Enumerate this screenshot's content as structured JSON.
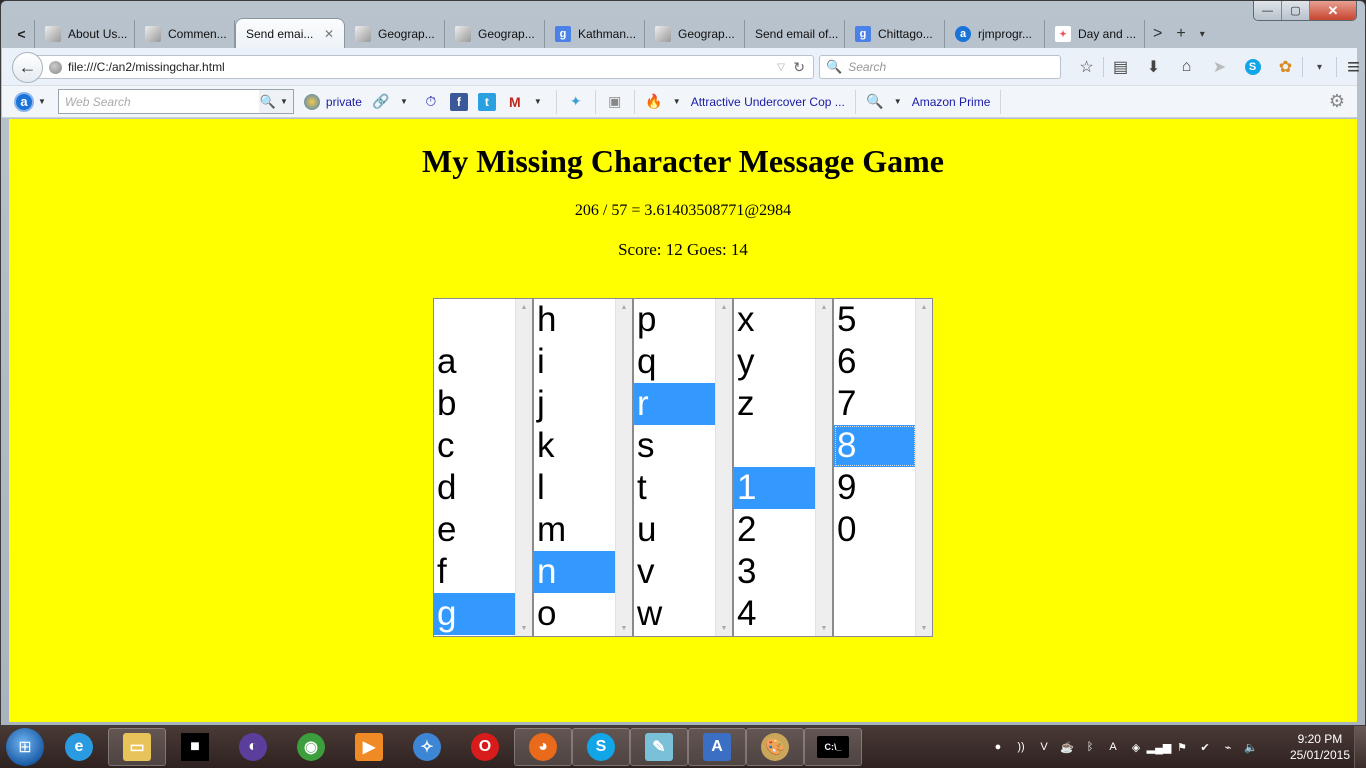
{
  "window": {
    "controls": {
      "minimize": "—",
      "maximize": "▢",
      "close": "✕"
    }
  },
  "tabs": [
    {
      "label": "About Us...",
      "favicon": "globe-favicon"
    },
    {
      "label": "Commen...",
      "favicon": "globe-favicon"
    },
    {
      "label": "Send emai...",
      "favicon": "none",
      "active": true
    },
    {
      "label": "Geograp...",
      "favicon": "globe-favicon"
    },
    {
      "label": "Geograp...",
      "favicon": "globe-favicon"
    },
    {
      "label": "Kathman...",
      "favicon": "google-favicon"
    },
    {
      "label": "Geograp...",
      "favicon": "globe-favicon"
    },
    {
      "label": "Send email of...",
      "favicon": "none"
    },
    {
      "label": "Chittago...",
      "favicon": "google-favicon"
    },
    {
      "label": "rjmprogr...",
      "favicon": "a-favicon"
    },
    {
      "label": "Day and ...",
      "favicon": "day-favicon"
    }
  ],
  "tab_glyphs": {
    "scroll_left": "<",
    "close": "✕",
    "scroll_right": ">",
    "new_tab": "+",
    "list_all": "▾",
    "google": "g",
    "a": "a",
    "day": "✦"
  },
  "navbar": {
    "back": "←",
    "url": "file:///C:/an2/missingchar.html",
    "url_dropdown": "▽",
    "reload": "↻",
    "search_placeholder": "Search",
    "search_icon": "🔍",
    "icons": {
      "bookmark": "☆",
      "reading_list": "▤",
      "download": "⬇",
      "home": "⌂",
      "send": "➤",
      "skype": "S",
      "bug": "✿",
      "more": "▾",
      "menu": "≡"
    }
  },
  "toolbar": {
    "a_logo": "a",
    "caret": "▼",
    "web_search_placeholder": "Web Search",
    "search_icon": "🔍",
    "private_label": "private",
    "link_icon": "🔗",
    "timer_icon": "⏱",
    "facebook_icon": "f",
    "twitter_icon": "t",
    "gmail_icon": "M",
    "sparkle_icon": "✦",
    "contact_icon": "▣",
    "fire_icon": "🔥",
    "attractive_label": "Attractive Undercover Cop ...",
    "search_fire_icon": "🔍",
    "amazon_label": "Amazon Prime",
    "gear_icon": "⚙"
  },
  "page": {
    "title": "My Missing Character Message Game",
    "equation": "206 / 57 = 3.61403508771@2984",
    "score_line": "Score: 12 Goes: 14",
    "selects": [
      {
        "options": [
          "",
          "a",
          "b",
          "c",
          "d",
          "e",
          "f",
          "g"
        ],
        "selected": "g"
      },
      {
        "options": [
          "h",
          "i",
          "j",
          "k",
          "l",
          "m",
          "n",
          "o"
        ],
        "selected": "n"
      },
      {
        "options": [
          "p",
          "q",
          "r",
          "s",
          "t",
          "u",
          "v",
          "w"
        ],
        "selected": "r"
      },
      {
        "options": [
          "x",
          "y",
          "z",
          "",
          "1",
          "2",
          "3",
          "4"
        ],
        "selected": "1"
      },
      {
        "options": [
          "5",
          "6",
          "7",
          "8",
          "9",
          "0"
        ],
        "selected": "8",
        "focused": true
      }
    ],
    "scroll_up": "▲",
    "scroll_down": "▼"
  },
  "taskbar": {
    "start": "⊞",
    "apps": [
      {
        "name": "internet-explorer",
        "glyph": "e",
        "color": "#2a9be0"
      },
      {
        "name": "file-explorer",
        "glyph": "▭",
        "color": "#e8c35a",
        "open": true
      },
      {
        "name": "terminal-app",
        "glyph": "■",
        "color": "#000000"
      },
      {
        "name": "eclipse",
        "glyph": "◐",
        "color": "#5b3e9c"
      },
      {
        "name": "chrome",
        "glyph": "◉",
        "color": "#3d9e3d"
      },
      {
        "name": "media-player",
        "glyph": "▶",
        "color": "#f08a24"
      },
      {
        "name": "safari",
        "glyph": "✧",
        "color": "#3d86d6"
      },
      {
        "name": "opera",
        "glyph": "O",
        "color": "#d81b1b"
      },
      {
        "name": "firefox",
        "glyph": "◕",
        "color": "#e86a1a",
        "open": true
      },
      {
        "name": "skype",
        "glyph": "S",
        "color": "#12a5e8",
        "open": true
      },
      {
        "name": "notepad",
        "glyph": "✎",
        "color": "#7ac0d8",
        "open": true
      },
      {
        "name": "wordpad",
        "glyph": "A",
        "color": "#3a6fc4",
        "open": true
      },
      {
        "name": "paint",
        "glyph": "🎨",
        "color": "#c9a65a",
        "open": true
      },
      {
        "name": "command-prompt",
        "glyph": "C:\\_",
        "color": "#000000",
        "open": true
      }
    ],
    "tray_icons": [
      "●",
      "))",
      "V",
      "☕",
      "ᛒ",
      "A",
      "◈",
      "▂▄▆",
      "⚑",
      "✔",
      "⌁",
      "🔈"
    ],
    "time": "9:20 PM",
    "date": "25/01/2015"
  }
}
